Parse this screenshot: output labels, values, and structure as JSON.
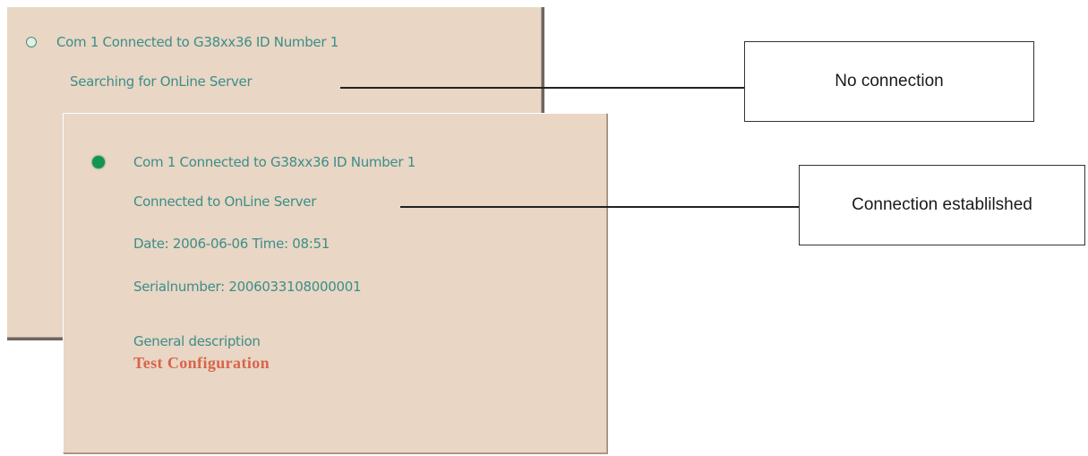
{
  "colors": {
    "panel_bg": "#e9d6c4",
    "panel_text": "#3b8e89",
    "accent_text": "#d8644c",
    "status_disconnected": "#ddf0e3",
    "status_connected": "#129453",
    "callout_border": "#333333"
  },
  "icons": {
    "status_disconnected": "hollow-circle-icon",
    "status_connected": "filled-circle-icon"
  },
  "panel_disconnected": {
    "com_line": "Com 1 Connected to  G38xx36 ID Number 1",
    "status_line": "Searching for OnLine Server",
    "status": "not connected"
  },
  "panel_connected": {
    "com_line": "Com 1 Connected to  G38xx36 ID Number 1",
    "status_line": "Connected to OnLine Server",
    "date_time_line": "Date: 2006-06-06  Time: 08:51",
    "serial_line": "Serialnumber: 2006033108000001",
    "description_label": "General description",
    "description_value": "Test Configuration",
    "status": "connected"
  },
  "callouts": {
    "no_connection": "No connection",
    "connection_established": "Connection establilshed"
  }
}
